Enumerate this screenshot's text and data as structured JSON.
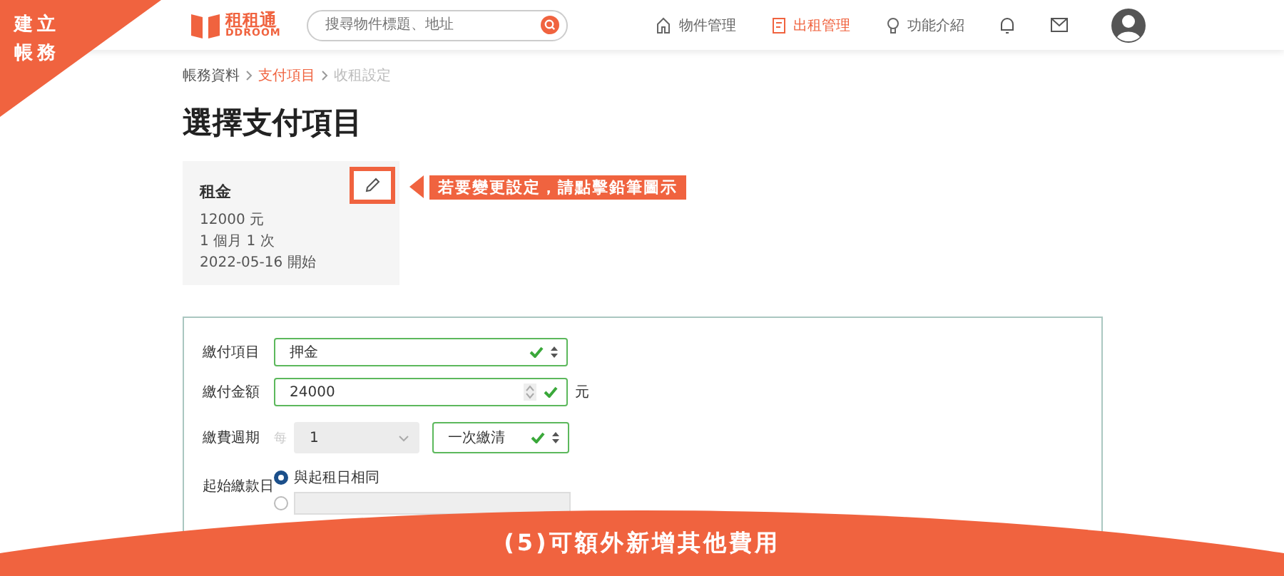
{
  "corner_label": {
    "lines": [
      "建立",
      "帳務"
    ]
  },
  "header": {
    "logo": {
      "name": "租租通",
      "sub": "DDROOM"
    },
    "search": {
      "placeholder": "搜尋物件標題、地址"
    },
    "nav": [
      {
        "label": "物件管理",
        "selected": false
      },
      {
        "label": "出租管理",
        "selected": true
      },
      {
        "label": "功能介紹",
        "selected": false
      }
    ]
  },
  "breadcrumb": [
    {
      "label": "帳務資料",
      "selected": false,
      "disabled": false
    },
    {
      "label": "支付項目",
      "selected": true,
      "disabled": false
    },
    {
      "label": "收租設定",
      "selected": false,
      "disabled": true
    }
  ],
  "page_title": "選擇支付項目",
  "payment_card": {
    "title": "租金",
    "lines": [
      "12000 元",
      "1 個月 1 次",
      "2022-05-16 開始"
    ]
  },
  "callout": "若要變更設定，請點擊鉛筆圖示",
  "form": {
    "item": {
      "label": "繳付項目",
      "value": "押金"
    },
    "amount": {
      "label": "繳付金額",
      "value": "24000",
      "unit": "元"
    },
    "cycle": {
      "label": "繳費週期",
      "prefix": "每",
      "count": "1",
      "count_disabled": true,
      "mode": "一次繳清"
    },
    "start": {
      "label": "起始繳款日",
      "options": [
        {
          "label": "與起租日相同",
          "selected": true
        },
        {
          "kind": "date",
          "selected": false
        }
      ]
    }
  },
  "banner": "(5)可額外新增其他費用"
}
